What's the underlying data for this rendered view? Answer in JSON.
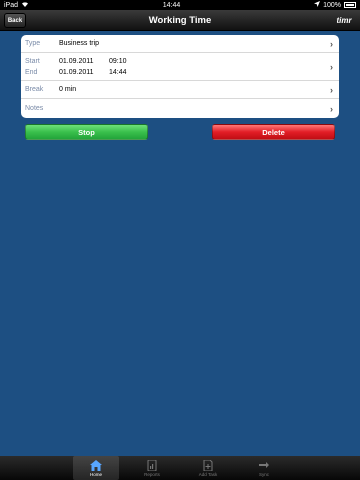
{
  "status_bar": {
    "carrier": "iPad",
    "time": "14:44",
    "battery": "100%",
    "icons": [
      "wifi-icon",
      "location-icon",
      "battery-icon"
    ]
  },
  "nav": {
    "back_label": "Back",
    "title": "Working Time",
    "logo_text": "timr"
  },
  "details": {
    "type_label": "Type",
    "type_value": "Business trip",
    "start_label": "Start",
    "start_date": "01.09.2011",
    "start_time": "09:10",
    "end_label": "End",
    "end_date": "01.09.2011",
    "end_time": "14:44",
    "break_label": "Break",
    "break_value": "0 min",
    "notes_label": "Notes",
    "notes_value": ""
  },
  "actions": {
    "stop_label": "Stop",
    "delete_label": "Delete"
  },
  "tabs": [
    {
      "label": "Home",
      "icon": "home-icon",
      "active": true
    },
    {
      "label": "Reports",
      "icon": "reports-icon",
      "active": false
    },
    {
      "label": "Add Task",
      "icon": "add-task-icon",
      "active": false
    },
    {
      "label": "Sync",
      "icon": "sync-icon",
      "active": false
    }
  ],
  "colors": {
    "background": "#1d4f82",
    "stop": "#3ac04c",
    "delete": "#e21e26"
  }
}
